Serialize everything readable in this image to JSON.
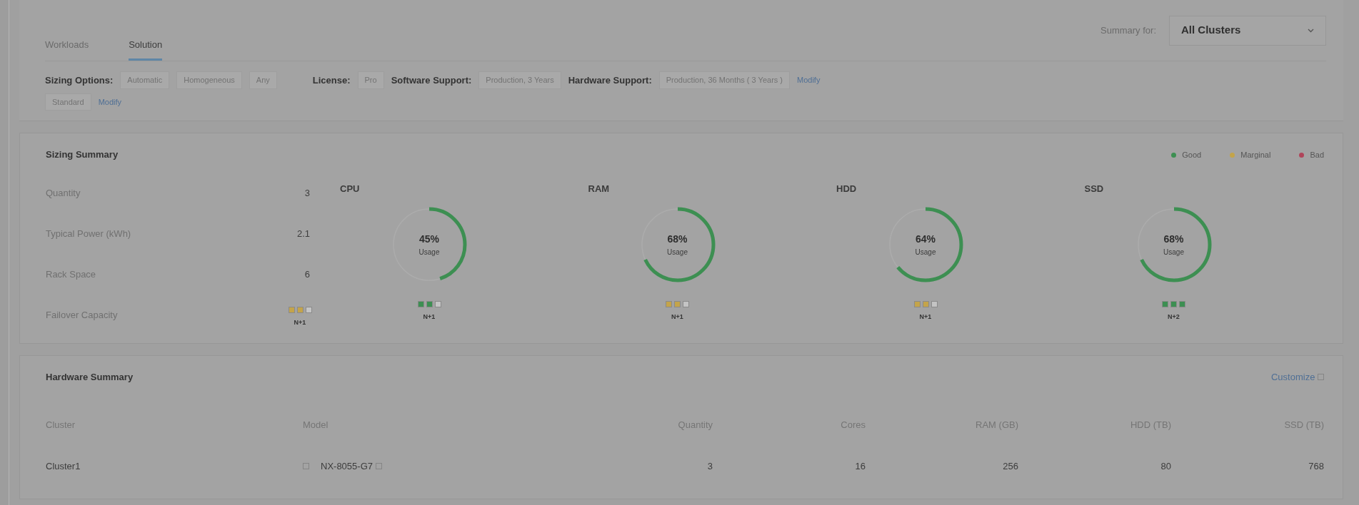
{
  "tabs": [
    {
      "label": "Workloads",
      "selected": false
    },
    {
      "label": "Solution",
      "selected": true
    }
  ],
  "summary_for": {
    "label": "Summary for:",
    "value": "All Clusters"
  },
  "options_rows": [
    [
      {
        "kind": "label",
        "text": "Sizing Options:"
      },
      {
        "kind": "chip",
        "text": "Automatic"
      },
      {
        "kind": "chip",
        "text": "Homogeneous"
      },
      {
        "kind": "chip",
        "text": "Any"
      },
      {
        "kind": "gap"
      },
      {
        "kind": "label",
        "text": "License:"
      },
      {
        "kind": "chip",
        "text": "Pro"
      },
      {
        "kind": "label",
        "text": "Software Support:"
      },
      {
        "kind": "chip",
        "text": "Production, 3 Years"
      },
      {
        "kind": "label",
        "text": "Hardware Support:"
      },
      {
        "kind": "chip",
        "text": "Production, 36 Months ( 3 Years )"
      },
      {
        "kind": "link",
        "text": "Modify"
      }
    ],
    [
      {
        "kind": "chip",
        "text": "Standard"
      },
      {
        "kind": "link",
        "text": "Modify"
      }
    ]
  ],
  "sizing_summary": {
    "title": "Sizing Summary",
    "legend": [
      {
        "label": "Good",
        "color": "#3d8f52"
      },
      {
        "label": "Marginal",
        "color": "#c4a44a"
      },
      {
        "label": "Bad",
        "color": "#b0455a"
      }
    ],
    "metrics": [
      {
        "label": "Quantity",
        "value": "3"
      },
      {
        "label": "Typical Power (kWh)",
        "value": "2.1"
      },
      {
        "label": "Rack Space",
        "value": "6"
      }
    ],
    "failover": {
      "label": "Failover Capacity",
      "stars": 2,
      "color": "#c4a44a",
      "text": "N+1"
    },
    "resources": [
      {
        "name": "CPU",
        "percent": "45%",
        "caption": "Usage",
        "level": 0.45,
        "failover": {
          "stars": 2,
          "color": "#3d8f52",
          "text": "N+1"
        }
      },
      {
        "name": "RAM",
        "percent": "68%",
        "caption": "Usage",
        "level": 0.68,
        "failover": {
          "stars": 2,
          "color": "#c4a44a",
          "text": "N+1"
        }
      },
      {
        "name": "HDD",
        "percent": "64%",
        "caption": "Usage",
        "level": 0.64,
        "failover": {
          "stars": 2,
          "color": "#c4a44a",
          "text": "N+1"
        }
      },
      {
        "name": "SSD",
        "percent": "68%",
        "caption": "Usage",
        "level": 0.68,
        "failover": {
          "stars": 3,
          "color": "#3d8f52",
          "text": "N+2"
        }
      }
    ]
  },
  "hardware_summary": {
    "title": "Hardware Summary",
    "action": "Customize",
    "columns": [
      "Cluster",
      "Model",
      "Quantity",
      "Cores",
      "RAM (GB)",
      "HDD (TB)",
      "SSD (TB)"
    ],
    "rows": [
      [
        "Cluster1",
        "NX-8055-G7",
        "3",
        "16",
        "256",
        "80",
        "768"
      ]
    ]
  }
}
